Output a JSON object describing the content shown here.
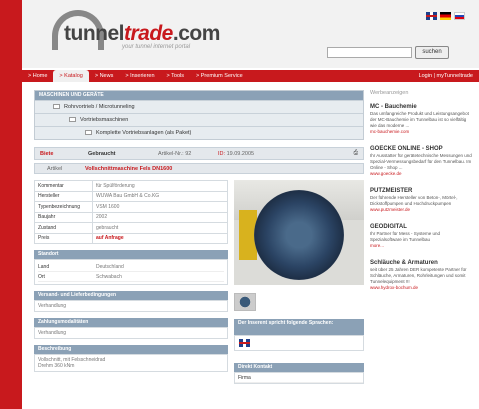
{
  "header": {
    "logo_main": "tunnel",
    "logo_accent": "trade",
    "logo_suffix": ".com",
    "logo_sub": "your tunnel internet portal",
    "search_button": "suchen"
  },
  "nav": {
    "items": [
      "> Home",
      "> Katalog",
      "> News",
      "> Inserieren",
      "> Tools",
      "> Premium Service"
    ],
    "right": "Login | myTunneltrade"
  },
  "tree": {
    "head": "MASCHINEN UND GERÄTE",
    "rows": [
      "Rohrvortrieb / Microtunneling",
      "Vortriebsmaschinen",
      "Komplette Vortriebsanlagen (als Paket)"
    ]
  },
  "status": {
    "type": "Biete",
    "condition": "Gebraucht",
    "article_no": "Artikel-Nr.: 92",
    "id_label": "ID:",
    "date": "19.09.2005"
  },
  "article": {
    "label": "Artikel",
    "title": "Vollschnittmaschine Fels DN1600"
  },
  "specs": [
    {
      "k": "Kommentar",
      "v": "für Spülförderung"
    },
    {
      "k": "Hersteller",
      "v": "WUWA Bau GmbH & Co.KG"
    },
    {
      "k": "Typenbezeichnung",
      "v": "VSM 1600"
    },
    {
      "k": "Baujahr",
      "v": "2002"
    },
    {
      "k": "Zustand",
      "v": "gebraucht"
    },
    {
      "k": "Preis",
      "v": "auf Anfrage"
    }
  ],
  "standort": {
    "head": "Standort",
    "rows": [
      {
        "k": "Land",
        "v": "Deutschland"
      },
      {
        "k": "Ort",
        "v": "Schwabach"
      }
    ]
  },
  "versand": {
    "head": "Versand- und Lieferbedingungen",
    "text": "Verhandlung"
  },
  "zahlung": {
    "head": "Zahlungsmodalitäten",
    "text": "Verhandlung"
  },
  "beschreibung": {
    "head": "Beschreibung",
    "lines": [
      "Vollschnitt, mit Felsschneidrad",
      "Drehm 360 kNm"
    ]
  },
  "right_col": {
    "speaks_head": "Der Inserent spricht folgende Sprachen:",
    "contact_head": "Direkt Kontakt",
    "contact_row": "Firma"
  },
  "sidebar": {
    "title": "Werbeanzeigen",
    "ads": [
      {
        "title": "MC - Bauchemie",
        "text": "Das umfangreiche Produkt und Leistungsangebot der MC-Bauchemie im Tunnelbau ist so vielfältig wie das moderne ...",
        "link": "mc-bauchemie.com"
      },
      {
        "title": "GOECKE ONLINE - SHOP",
        "text": "Ihr Ausstatter für gerätetechnische Messungen und Spezial-Vermessungsbedarf für den Tunnelbau. Im Online - Shop ...",
        "link": "www.goecke.de"
      },
      {
        "title": "PUTZMEISTER",
        "text": "Der führende Hersteller von Beton-, Mörtel-, Dickstoffpumpen und Hochdruckpumpen",
        "link": "www.putzmeister.de"
      },
      {
        "title": "GEODIGITAL",
        "text": "Ihr Partner für Mess - Systeme und Spezialsoftware im Tunnelbau",
        "link": "more..."
      },
      {
        "title": "Schläuche & Armaturen",
        "text": "seit über 25 Jahren DER kompetente Partner für Schläuche, Armaturen, Rohrleitungen und somit Tunnelequipment !!!",
        "link": "www.hydrox-bochum.de"
      }
    ]
  }
}
